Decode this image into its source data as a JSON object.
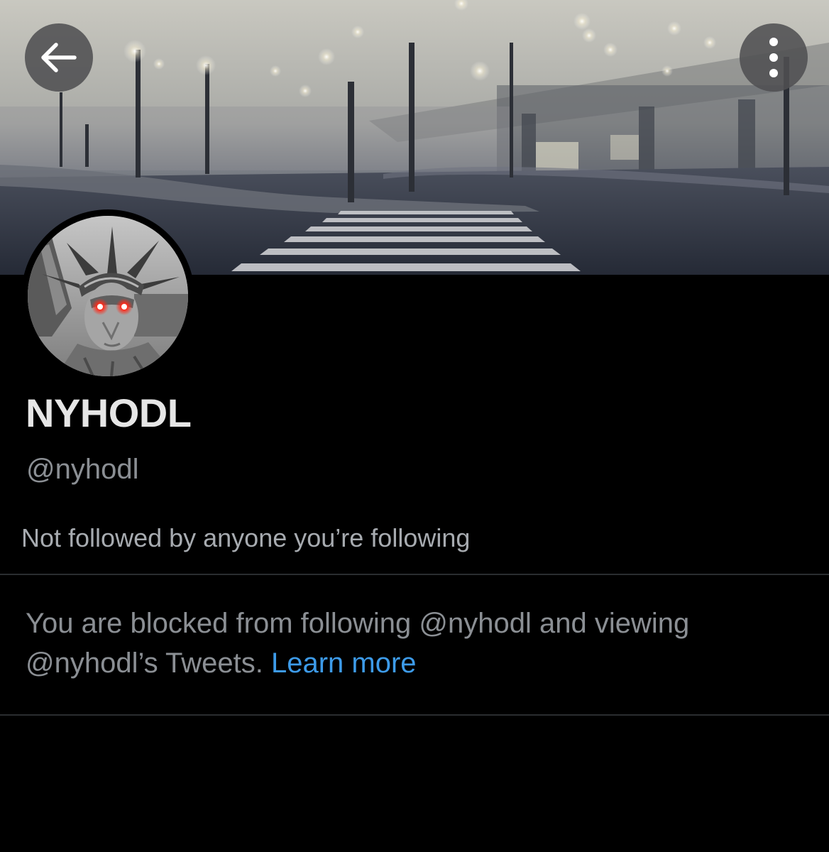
{
  "header": {
    "back_icon": "arrow-left-icon",
    "more_icon": "more-vertical-icon",
    "banner_description": "foggy night street crossing"
  },
  "profile": {
    "display_name": "NYHODL",
    "handle": "@nyhodl",
    "followed_by_note": "Not followed by anyone you’re following",
    "avatar_description": "statue of liberty with glowing red eyes"
  },
  "blocked_notice": {
    "text": "You are blocked from following @nyhodl and viewing @nyhodl’s Tweets.",
    "link_label": "Learn more"
  },
  "colors": {
    "background": "#000000",
    "link": "#3d9be9",
    "laser_eyes": "#ff2a1a"
  }
}
